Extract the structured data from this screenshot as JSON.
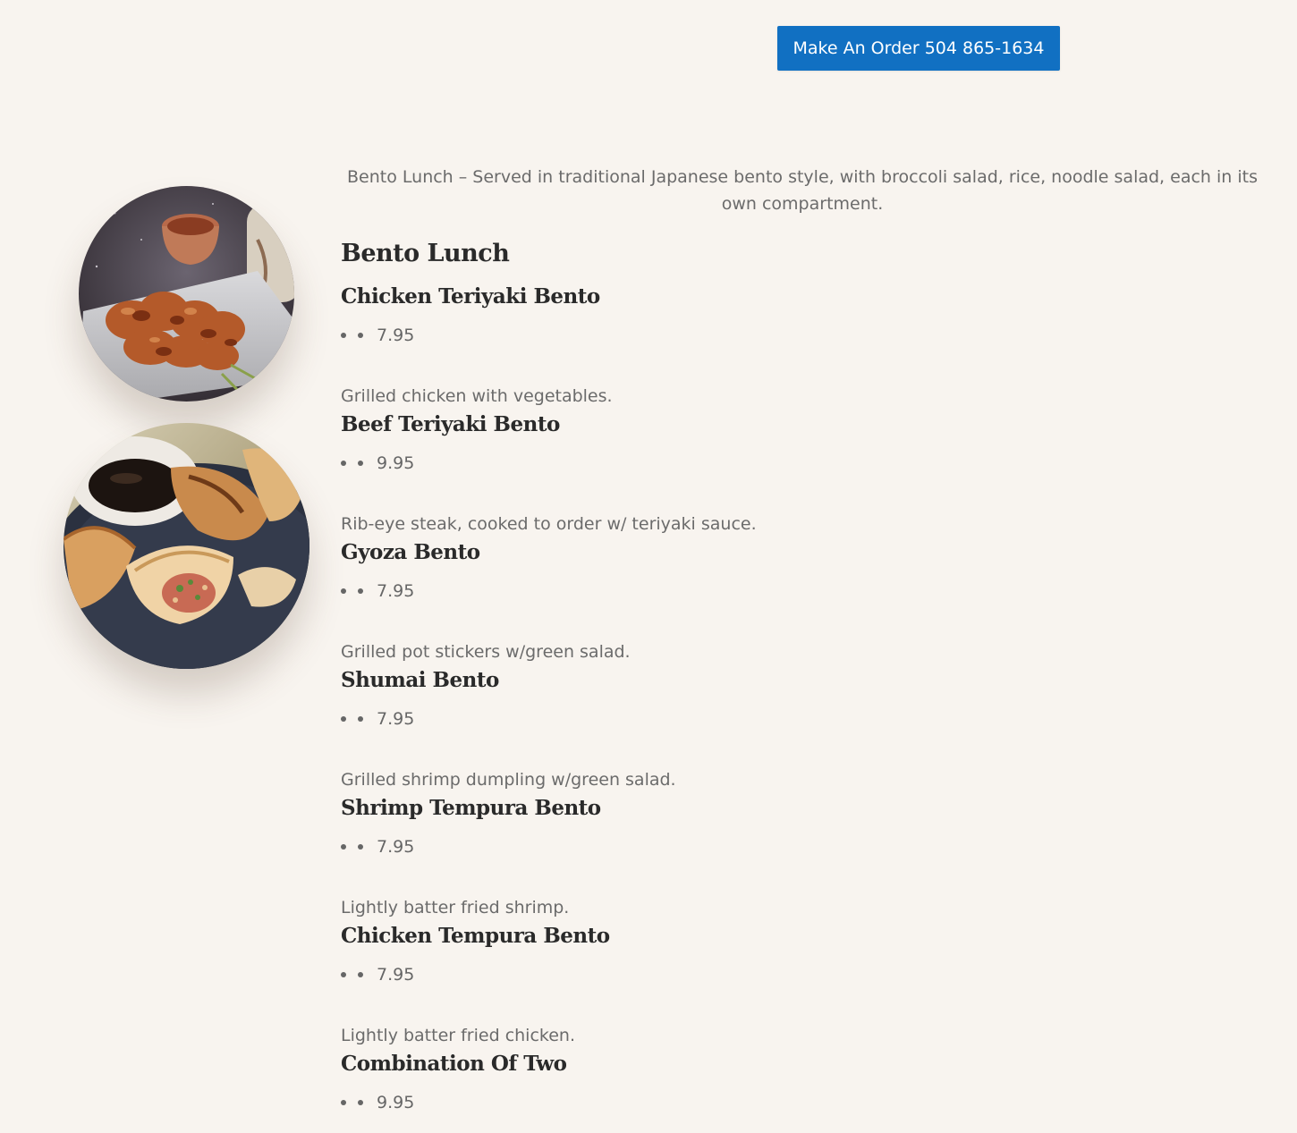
{
  "order_button": {
    "label": "Make An Order 504 865-1634"
  },
  "intro_text": "Bento Lunch – Served in traditional Japanese bento style, with broccoli salad, rice, noodle salad, each in its own compartment.",
  "section_title": "Bento Lunch",
  "items": [
    {
      "name": "Chicken Teriyaki Bento",
      "price": "7.95",
      "description": "Grilled chicken with vegetables."
    },
    {
      "name": "Beef Teriyaki Bento",
      "price": "9.95",
      "description": "Rib-eye steak, cooked to order w/ teriyaki sauce."
    },
    {
      "name": "Gyoza Bento",
      "price": "7.95",
      "description": "Grilled pot stickers w/green salad."
    },
    {
      "name": "Shumai Bento",
      "price": "7.95",
      "description": "Grilled shrimp dumpling w/green salad."
    },
    {
      "name": "Shrimp Tempura Bento",
      "price": "7.95",
      "description": "Lightly batter fried shrimp."
    },
    {
      "name": "Chicken Tempura Bento",
      "price": "7.95",
      "description": "Lightly batter fried chicken."
    },
    {
      "name": "Combination Of Two",
      "price": "9.95",
      "description": ""
    }
  ],
  "colors": {
    "background": "#f8f4ef",
    "button": "#1170c2",
    "heading": "#2a2a2a",
    "body_text": "#666666"
  }
}
